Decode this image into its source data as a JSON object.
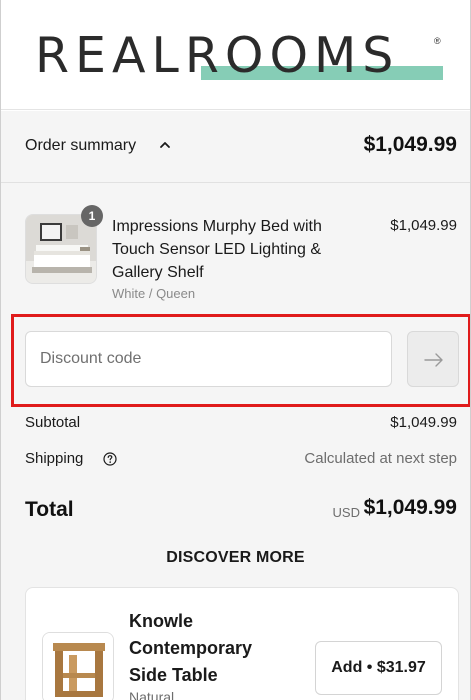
{
  "brand": {
    "logo_text": "REALROOMS",
    "logo_mark": "®",
    "accent_color": "#86cdb6"
  },
  "order_summary": {
    "toggle_label": "Order summary",
    "toggle_icon": "chevron-up-icon",
    "total": "$1,049.99"
  },
  "line_item": {
    "quantity": "1",
    "name": "Impressions Murphy Bed with Touch Sensor LED Lighting & Gallery Shelf",
    "variant": "White / Queen",
    "price": "$1,049.99"
  },
  "discount": {
    "placeholder": "Discount code",
    "apply_icon": "arrow-right-icon",
    "highlight_color": "#e01b1b"
  },
  "totals": {
    "subtotal_label": "Subtotal",
    "subtotal_value": "$1,049.99",
    "shipping_label": "Shipping",
    "shipping_icon": "question-circle-icon",
    "shipping_value": "Calculated at next step",
    "total_label": "Total",
    "total_currency": "USD",
    "total_value": "$1,049.99"
  },
  "discover": {
    "heading": "DISCOVER MORE",
    "product": {
      "title": "Knowle Contemporary Side Table",
      "variant": "Natural",
      "add_label": "Add • $31.97"
    }
  }
}
